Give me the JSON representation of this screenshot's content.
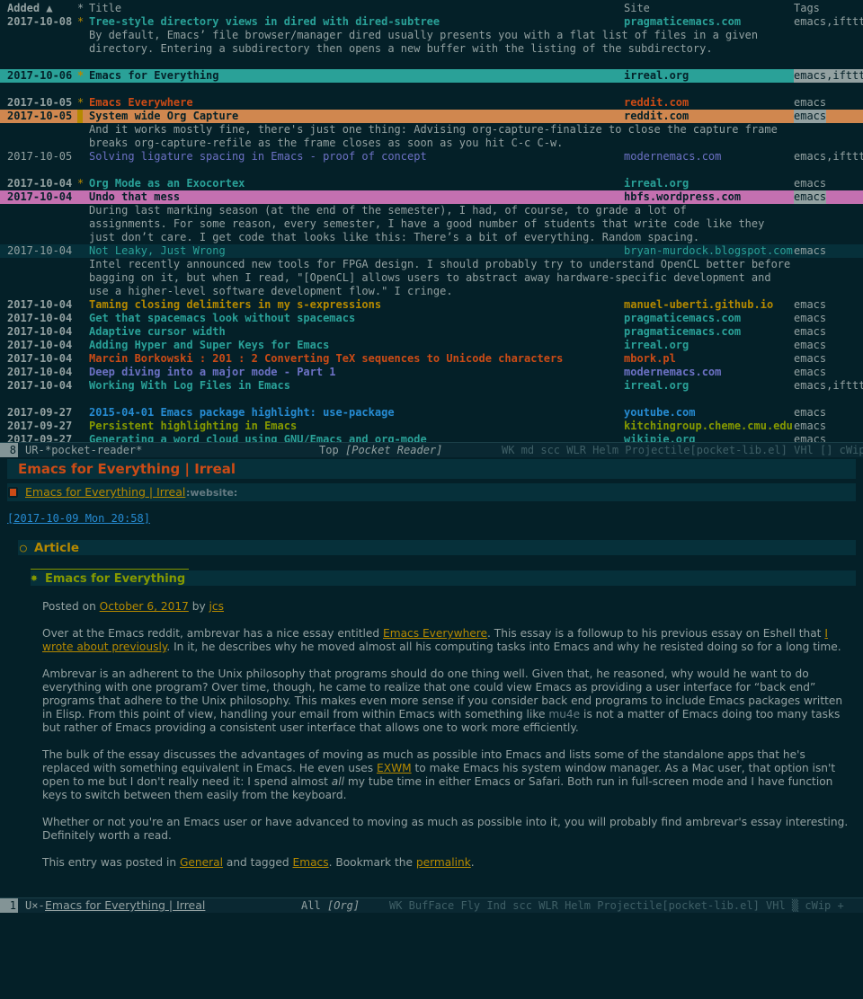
{
  "list": {
    "headers": {
      "added": "Added ▲",
      "star": "*",
      "title": "Title",
      "site": "Site",
      "tags": "Tags"
    },
    "rows": [
      {
        "date": "2017-10-08",
        "star": "*",
        "title": "Tree-style directory views in dired with dired-subtree",
        "site": "pragmaticemacs.com",
        "tags": "emacs,ifttt",
        "titleColor": "#2aa198",
        "siteColor": "#2aa198",
        "bold": true,
        "excerpt": [
          "By default, Emacs’ file browser/manager dired usually presents you with a flat list of files in a given",
          "directory. Entering a subdirectory then opens a new buffer with the listing of the subdirectory."
        ]
      },
      {
        "date": "2017-10-06",
        "star": "*",
        "title": "Emacs for Everything",
        "site": "irreal.org",
        "tags": "emacs,ifttt",
        "highlight": "#2aa198",
        "bold": true
      },
      {
        "date": "2017-10-05",
        "star": "*",
        "title": "Emacs Everywhere",
        "site": "reddit.com",
        "tags": "emacs",
        "titleColor": "#cb4b16",
        "siteColor": "#cb4b16",
        "bold": true
      },
      {
        "date": "2017-10-05",
        "star": "",
        "title": "System wide Org Capture",
        "site": "reddit.com",
        "tags": "emacs",
        "highlight": "#d0874f",
        "excerpt": [
          "And it works mostly fine, there's just one thing: Advising org-capture-finalize to close the capture frame",
          "breaks org-capture-refile as the frame closes as soon as you hit C-c C-w."
        ]
      },
      {
        "date": "2017-10-05",
        "star": "",
        "title": "Solving ligature spacing in Emacs - proof of concept",
        "site": "modernemacs.com",
        "tags": "emacs,ifttt",
        "titleColor": "#6c71c4",
        "siteColor": "#6c71c4"
      },
      {
        "date": "2017-10-04",
        "star": "*",
        "title": "Org Mode as an Exocortex",
        "site": "irreal.org",
        "tags": "emacs",
        "titleColor": "#2aa198",
        "siteColor": "#2aa198",
        "bold": true
      },
      {
        "date": "2017-10-04",
        "star": "",
        "title": "Undo that mess",
        "site": "hbfs.wordpress.com",
        "tags": "emacs",
        "highlight": "#c470b0",
        "bold": true,
        "excerpt": [
          "During last marking season (at the end of the semester), I had, of course, to grade a lot of",
          "assignments. For some reason, every semester, I have a good number of students that write code like they",
          "just don’t care. I get code that looks like this: There’s a bit of everything. Random spacing."
        ]
      },
      {
        "date": "2017-10-04",
        "star": "",
        "title": "Not Leaky, Just Wrong",
        "site": "bryan-murdock.blogspot.com",
        "tags": "emacs",
        "titleColor": "#2aa198",
        "siteColor": "#2aa198",
        "current": true,
        "excerpt": [
          "Intel recently announced new tools for FPGA design. I should probably try to understand OpenCL better before",
          "bagging on it, but when I read, \"[OpenCL] allows users to abstract away hardware-specific development and",
          "use a higher-level software development flow.\" I cringe."
        ]
      },
      {
        "date": "2017-10-04",
        "star": "",
        "title": "Taming closing delimiters in my s-expressions",
        "site": "manuel-uberti.github.io",
        "tags": "emacs",
        "titleColor": "#b58900",
        "siteColor": "#b58900",
        "bold": true
      },
      {
        "date": "2017-10-04",
        "star": "",
        "title": "Get that spacemacs look without spacemacs",
        "site": "pragmaticemacs.com",
        "tags": "emacs",
        "titleColor": "#2aa198",
        "siteColor": "#2aa198",
        "bold": true
      },
      {
        "date": "2017-10-04",
        "star": "",
        "title": "Adaptive cursor width",
        "site": "pragmaticemacs.com",
        "tags": "emacs",
        "titleColor": "#2aa198",
        "siteColor": "#2aa198",
        "bold": true
      },
      {
        "date": "2017-10-04",
        "star": "",
        "title": "Adding Hyper and Super Keys for Emacs",
        "site": "irreal.org",
        "tags": "emacs",
        "titleColor": "#2aa198",
        "siteColor": "#2aa198",
        "bold": true
      },
      {
        "date": "2017-10-04",
        "star": "",
        "title": "Marcin Borkowski : 201 : 2 Converting TeX sequences to Unicode characters",
        "site": "mbork.pl",
        "tags": "emacs",
        "titleColor": "#cb4b16",
        "siteColor": "#cb4b16",
        "bold": true
      },
      {
        "date": "2017-10-04",
        "star": "",
        "title": "Deep diving into a major mode - Part 1",
        "site": "modernemacs.com",
        "tags": "emacs",
        "titleColor": "#6c71c4",
        "siteColor": "#6c71c4",
        "bold": true
      },
      {
        "date": "2017-10-04",
        "star": "",
        "title": "Working With Log Files in Emacs",
        "site": "irreal.org",
        "tags": "emacs,ifttt",
        "titleColor": "#2aa198",
        "siteColor": "#2aa198",
        "bold": true,
        "gapAfter": true
      },
      {
        "date": "2017-09-27",
        "star": "",
        "title": "2015-04-01 Emacs package highlight: use-package",
        "site": "youtube.com",
        "tags": "emacs",
        "titleColor": "#268bd2",
        "siteColor": "#268bd2",
        "bold": true
      },
      {
        "date": "2017-09-27",
        "star": "",
        "title": "Persistent highlighting in Emacs",
        "site": "kitchingroup.cheme.cmu.edu",
        "tags": "emacs",
        "titleColor": "#859900",
        "siteColor": "#859900",
        "bold": true
      },
      {
        "date": "2017-09-27",
        "star": "",
        "title": "Generating a word cloud using GNU/Emacs and org-mode",
        "site": "wikipie.org",
        "tags": "emacs",
        "titleColor": "#2aa198",
        "siteColor": "#2aa198",
        "bold": true
      }
    ]
  },
  "modeline_top": {
    "num": "8",
    "left": "UR-",
    "buffer": "*pocket-reader*",
    "pos": "Top",
    "mode": "[Pocket Reader]",
    "minor": "WK md scc WLR Helm Projectile[pocket-lib.el] VHl [] cWip"
  },
  "article": {
    "title": "Emacs for Everything | Irreal",
    "title_link": "Emacs for Everything | Irreal",
    "website_tag": ":website:",
    "timestamp": "[2017-10-09 Mon 20:58]",
    "section": "Article",
    "subsection": "Emacs for Everything",
    "posted_prefix": "Posted on ",
    "posted_date": "October 6, 2017",
    "posted_by": " by ",
    "posted_author": "jcs",
    "p1_a": "Over at the Emacs reddit, ambrevar has a nice essay entitled ",
    "p1_link1": "Emacs Everywhere",
    "p1_b": ". This essay is a followup to his previous essay on Eshell that ",
    "p1_link2": "I wrote about previously",
    "p1_c": ". In it, he describes why he moved almost all his computing tasks into Emacs and why he resisted doing so for a long time.",
    "p2_a": "Ambrevar is an adherent to the Unix philosophy that programs should do one thing well. Given that, he reasoned, why would he want to do everything with one program? Over time, though, he came to realize that one could view Emacs as providing a user interface for “back end” programs that adhere to the Unix philosophy. This makes even more sense if you consider back end programs to include Emacs packages written in Elisp. From this point of view, handling your email from within Emacs with something like ",
    "p2_code": "mu4e",
    "p2_b": " is not a matter of Emacs doing too many tasks but rather of Emacs providing a consistent user interface that allows one to work more efficiently.",
    "p3_a": "The bulk of the essay discusses the advantages of moving as much as possible into Emacs and lists some of the standalone apps that he's replaced with something equivalent in Emacs. He even uses ",
    "p3_link": "EXWM",
    "p3_b": " to make Emacs his system window manager. As a Mac user, that option isn't open to me but I don't really need it: I spend almost ",
    "p3_em": "all",
    "p3_c": " my tube time in either Emacs or Safari. Both run in full-screen mode and I have function keys to switch between them easily from the keyboard.",
    "p4": "Whether or not you're an Emacs user or have advanced to moving as much as possible into it, you will probably find ambrevar's essay interesting. Definitely worth a read.",
    "p5_a": "This entry was posted in ",
    "p5_link1": "General",
    "p5_b": " and tagged ",
    "p5_link2": "Emacs",
    "p5_c": ". Bookmark the ",
    "p5_link3": "permalink",
    "p5_d": "."
  },
  "modeline_bottom": {
    "num": "1",
    "left": "U×-",
    "buffer": "Emacs for Everything | Irreal",
    "pos": "All",
    "mode": "[Org]",
    "minor": "WK BufFace Fly Ind scc WLR Helm Projectile[pocket-lib.el] VHl ▒ cWip +"
  }
}
